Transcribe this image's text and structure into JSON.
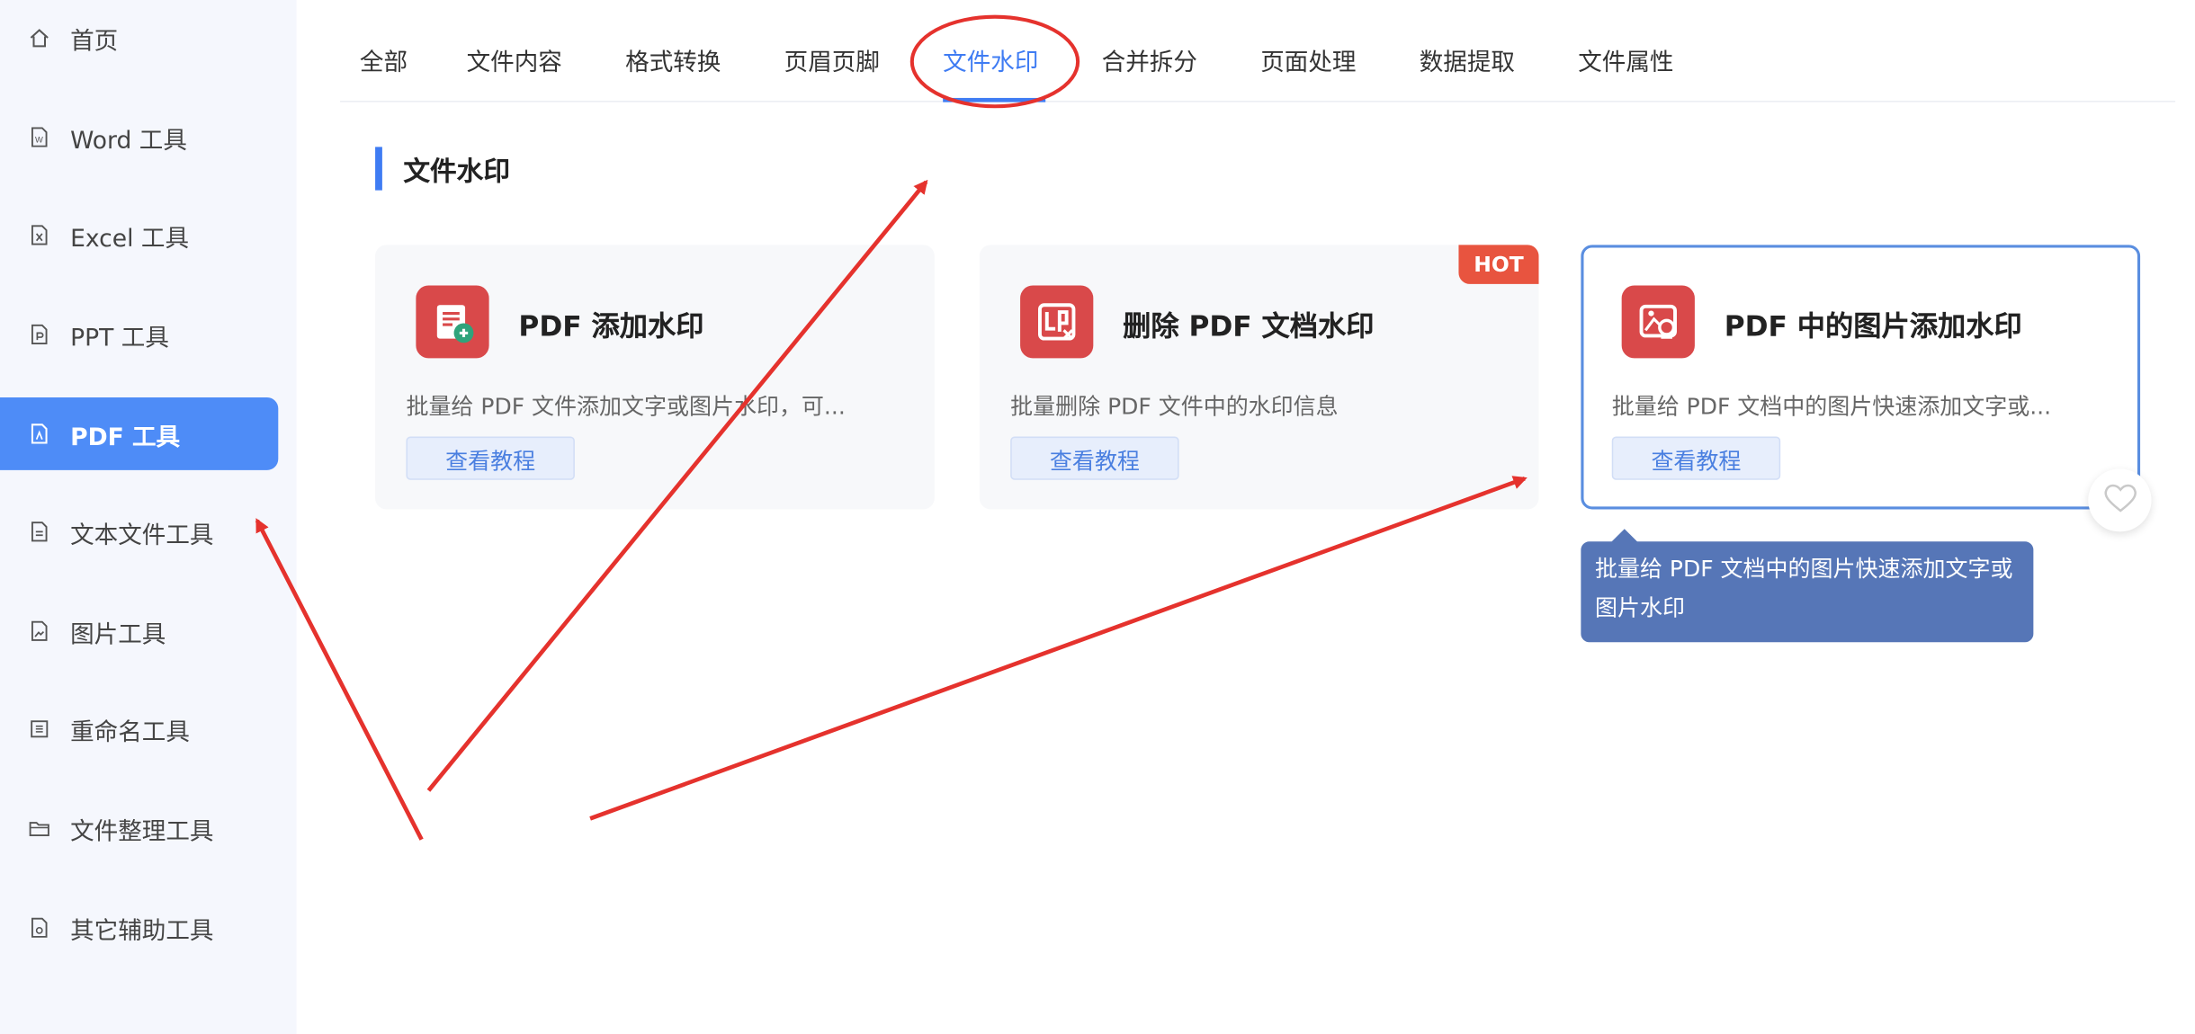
{
  "sidebar": {
    "items": [
      {
        "label": "首页",
        "icon": "home-icon"
      },
      {
        "label": "Word 工具",
        "icon": "word-file-icon"
      },
      {
        "label": "Excel 工具",
        "icon": "excel-file-icon"
      },
      {
        "label": "PPT 工具",
        "icon": "ppt-file-icon"
      },
      {
        "label": "PDF 工具",
        "icon": "pdf-file-icon",
        "active": true
      },
      {
        "label": "文本文件工具",
        "icon": "text-file-icon"
      },
      {
        "label": "图片工具",
        "icon": "image-file-icon"
      },
      {
        "label": "重命名工具",
        "icon": "rename-icon"
      },
      {
        "label": "文件整理工具",
        "icon": "folder-icon"
      },
      {
        "label": "其它辅助工具",
        "icon": "tools-file-icon"
      }
    ]
  },
  "tabs": [
    {
      "label": "全部"
    },
    {
      "label": "文件内容"
    },
    {
      "label": "格式转换"
    },
    {
      "label": "页眉页脚"
    },
    {
      "label": "文件水印",
      "active": true
    },
    {
      "label": "合并拆分"
    },
    {
      "label": "页面处理"
    },
    {
      "label": "数据提取"
    },
    {
      "label": "文件属性"
    }
  ],
  "section": {
    "title": "文件水印"
  },
  "cards": [
    {
      "title": "PDF 添加水印",
      "desc": "批量给 PDF 文件添加文字或图片水印，可...",
      "button": "查看教程",
      "icon": "pdf-add-watermark-icon"
    },
    {
      "title": "删除 PDF 文档水印",
      "desc": "批量删除 PDF 文件中的水印信息",
      "button": "查看教程",
      "icon": "remove-watermark-icon",
      "badge": "HOT"
    },
    {
      "title": "PDF 中的图片添加水印",
      "desc": "批量给 PDF 文档中的图片快速添加文字或...",
      "button": "查看教程",
      "icon": "image-watermark-icon"
    }
  ],
  "tooltip": {
    "text": "批量给 PDF 文档中的图片快速添加文字或图片水印"
  },
  "favorite": {
    "icon": "heart-icon"
  },
  "colors": {
    "accent": "#3f7cf3",
    "sidebar_active": "#4e8cf7",
    "card_icon": "#d9494a",
    "hot_badge": "#e8543f",
    "annotation": "#e5322d",
    "tooltip": "#5676b7"
  }
}
